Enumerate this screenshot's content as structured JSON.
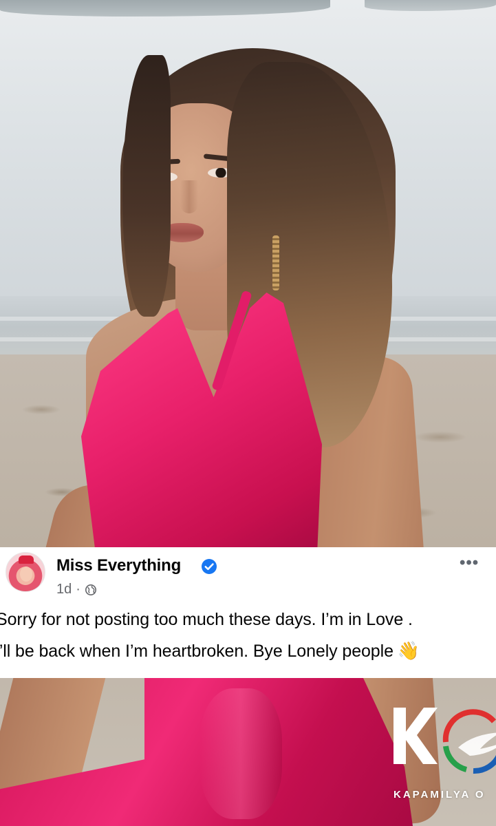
{
  "post": {
    "author": "Miss Everything",
    "verified": true,
    "time": "1d",
    "separator": "·",
    "audience_icon": "globe-icon",
    "more_label": "•••",
    "text_line_1": "Sorry for not posting too much these days. I’m in Love .",
    "text_line_2": "I’ll be back when I’m heartbroken. Bye Lonely people",
    "emoji": "👋"
  },
  "watermark": {
    "letter": "K",
    "text": "KAPAMILYA O"
  },
  "colors": {
    "verified_blue": "#1877f2",
    "dress_pink": "#e8206a",
    "meta_gray": "#65676b",
    "watermark_red": "#e0302f",
    "watermark_green": "#27a04a",
    "watermark_blue": "#1a5fb4"
  }
}
